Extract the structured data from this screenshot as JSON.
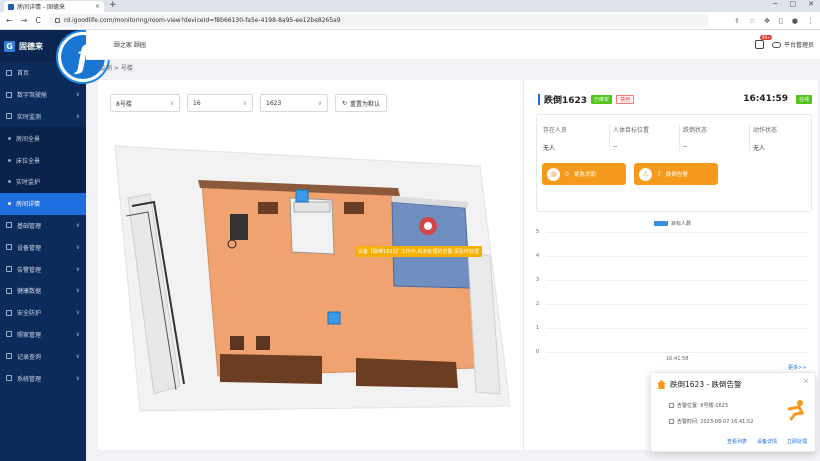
{
  "browser": {
    "tab_title": "房间详情 - 固德来",
    "tab_close": "×",
    "new_tab": "+",
    "back": "←",
    "forward": "→",
    "reload": "C",
    "url": "rd.igoodlife.com/monitoring/room-view?deviceId=f8b66130-fa5e-4198-8a95-ee12be8265a9"
  },
  "brand": {
    "icon_letter": "G",
    "name": "固德来"
  },
  "sidebar": {
    "items": [
      {
        "label": "首页",
        "type": "top",
        "chev": ""
      },
      {
        "label": "数字驾驶舱",
        "type": "top",
        "chev": "∨"
      },
      {
        "label": "实时监测",
        "type": "top",
        "chev": "∧"
      },
      {
        "label": "房间全景",
        "type": "sub",
        "chev": ""
      },
      {
        "label": "床位全景",
        "type": "sub",
        "chev": ""
      },
      {
        "label": "实时监护",
        "type": "sub",
        "chev": ""
      },
      {
        "label": "房间详情",
        "type": "sub-active",
        "chev": ""
      },
      {
        "label": "基础管理",
        "type": "top",
        "chev": "∨"
      },
      {
        "label": "设备管理",
        "type": "top",
        "chev": "∨"
      },
      {
        "label": "告警管理",
        "type": "top",
        "chev": "∨"
      },
      {
        "label": "健康数据",
        "type": "top",
        "chev": "∨"
      },
      {
        "label": "安全防护",
        "type": "top",
        "chev": "∨"
      },
      {
        "label": "照家管理",
        "type": "top",
        "chev": "∨"
      },
      {
        "label": "记录查询",
        "type": "top",
        "chev": "∨"
      },
      {
        "label": "系统管理",
        "type": "top",
        "chev": "∨"
      }
    ]
  },
  "header": {
    "tenant": "颐之家 颐园",
    "badge": "99+",
    "user": "平台管理员"
  },
  "breadcrumb": "监测 > 号楼",
  "filters": {
    "building": "8号楼",
    "floor": "16",
    "room": "1623",
    "reset_label": "重置为默认"
  },
  "map": {
    "alarm_tag": "设备【跌倒1623】工作中,有未处理的告警,请及时处理"
  },
  "room_panel": {
    "title": "跌倒1623",
    "tag_bound": "已绑定",
    "tag_disabled": "禁用",
    "time": "16:41:59",
    "online": "在线",
    "status": {
      "headers": [
        "存在人员",
        "人体目标位置",
        "跌倒状态",
        "动作状态"
      ],
      "values": [
        "无人",
        "--",
        "--",
        "无人"
      ]
    },
    "emergency": {
      "count": "0",
      "label": "紧急求助"
    },
    "fall_alarm": {
      "count": "7",
      "label": "跌倒告警"
    }
  },
  "chart_data": {
    "type": "bar",
    "legend": [
      "目标人数"
    ],
    "categories": [
      "16:41:58"
    ],
    "series": [
      {
        "name": "目标人数",
        "values": [
          0
        ]
      }
    ],
    "ylim": [
      0,
      5
    ],
    "yticks": [
      "5",
      "4",
      "3",
      "2",
      "1",
      "0"
    ],
    "xlabels": [
      "16:41:58"
    ],
    "more_link": "更多>>",
    "colors": {
      "series": "#3a8fe0"
    }
  },
  "popup": {
    "title": "跌倒1623 - 跌倒告警",
    "location": "告警位置: 8号楼-1623",
    "time": "告警时间: 2023-08-07 16:41:52",
    "actions": [
      "查看列表",
      "设备详情",
      "立即处理"
    ],
    "close": "×"
  },
  "colors": {
    "sidebar": "#0b2b5a",
    "accent": "#1f6ee0",
    "orange": "#f59a1c",
    "green": "#52c41a"
  }
}
